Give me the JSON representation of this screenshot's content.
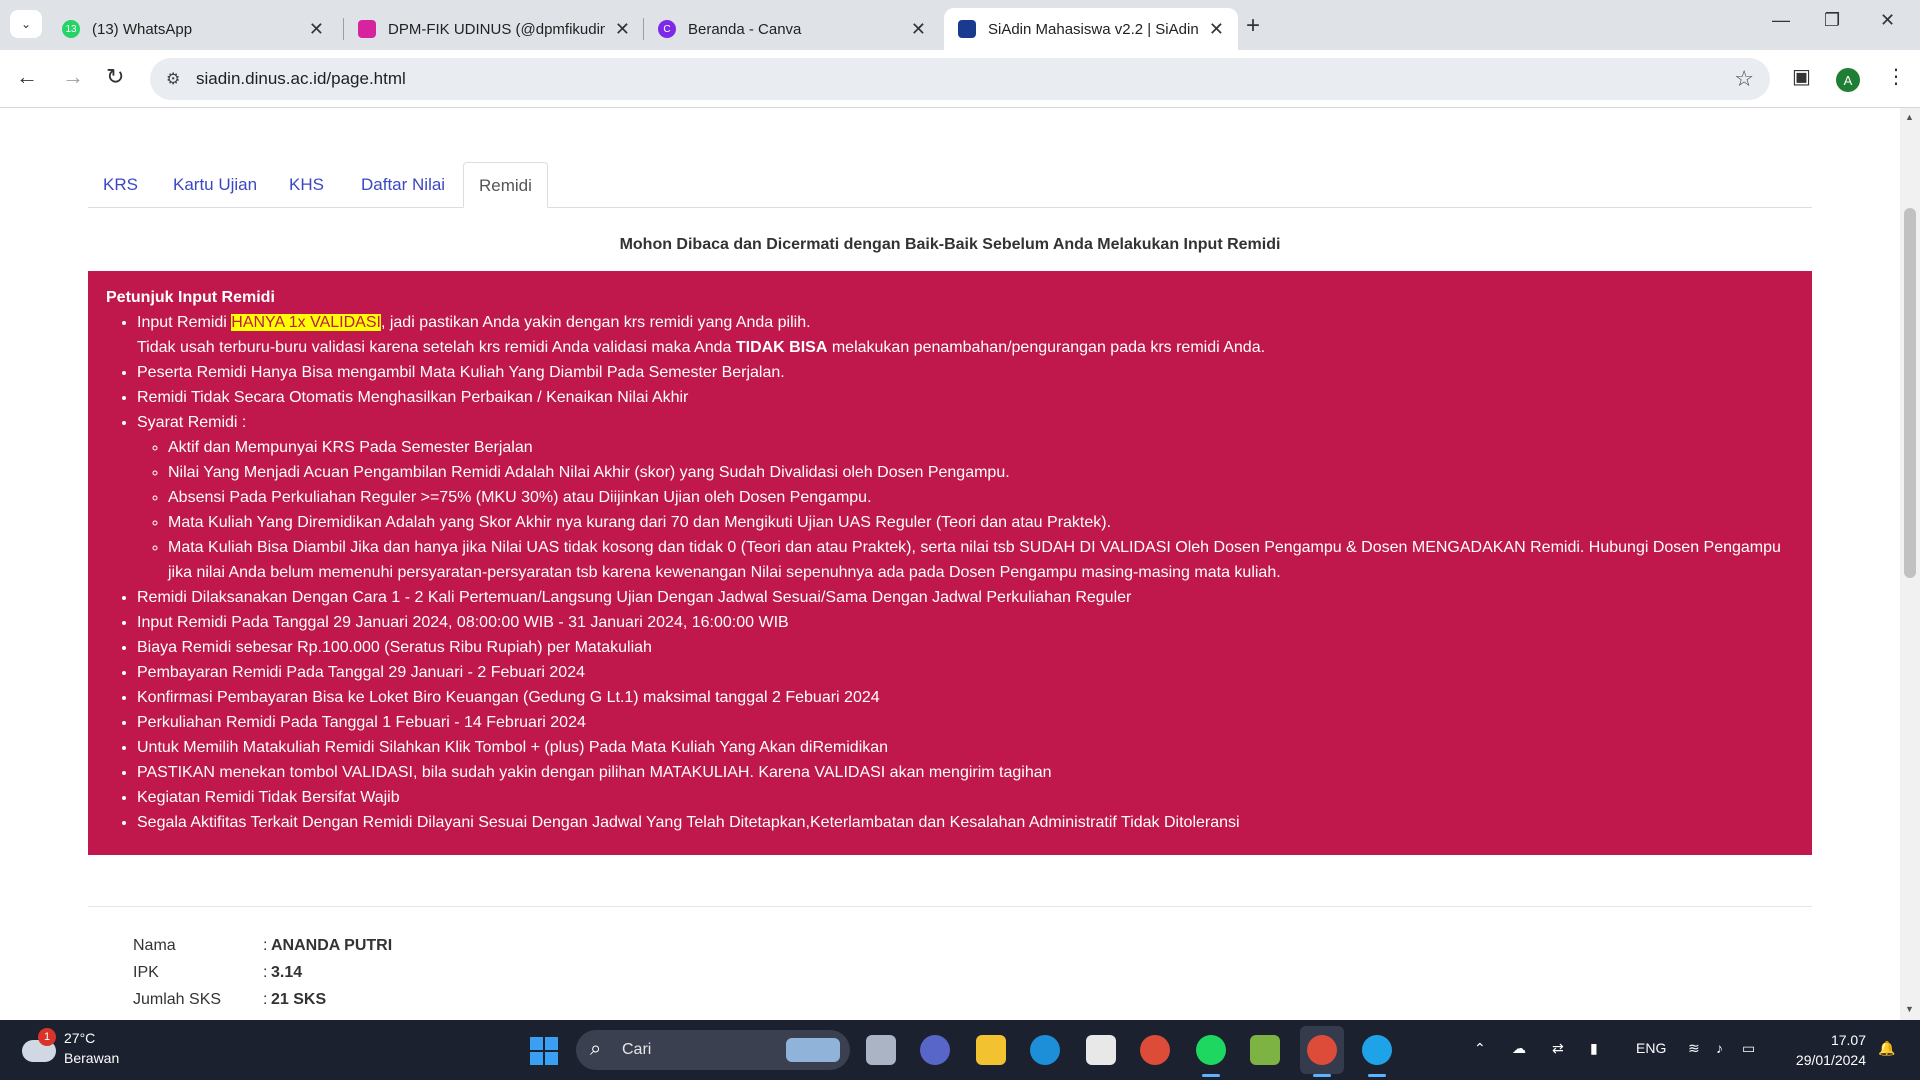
{
  "browser": {
    "tabs": [
      {
        "title": "(13) WhatsApp",
        "badge": "13",
        "color": "#25d366"
      },
      {
        "title": "DPM-FIK UDINUS (@dpmfikudinus)",
        "color": "#d6249f"
      },
      {
        "title": "Beranda - Canva",
        "color": "#7d2ae8"
      },
      {
        "title": "SiAdin Mahasiswa v2.2 | SiAdin",
        "color": "#1a3a8f"
      }
    ],
    "url": "siadin.dinus.ac.id/page.html",
    "profile_initial": "A"
  },
  "page": {
    "tabs": [
      "KRS",
      "Kartu Ujian",
      "KHS",
      "Daftar Nilai",
      "Remidi"
    ],
    "notice_title": "Mohon Dibaca dan Dicermati dengan Baik-Baik Sebelum Anda Melakukan Input Remidi",
    "box": {
      "title": "Petunjuk Input Remidi",
      "item1": {
        "a": "Input Remidi ",
        "highlight": "HANYA 1x VALIDASI",
        "b": ", jadi pastikan Anda yakin dengan krs remidi yang Anda pilih.",
        "c": "Tidak usah terburu-buru validasi karena setelah krs remidi Anda validasi maka Anda ",
        "bold": "TIDAK BISA",
        "d": " melakukan penambahan/pengurangan pada krs remidi Anda."
      },
      "item2": "Peserta Remidi Hanya Bisa mengambil Mata Kuliah Yang Diambil Pada Semester Berjalan.",
      "item3": "Remidi Tidak Secara Otomatis Menghasilkan Perbaikan / Kenaikan Nilai Akhir",
      "syarat_label": "Syarat Remidi :",
      "syarat": [
        "Aktif dan Mempunyai KRS Pada Semester Berjalan",
        "Nilai Yang Menjadi Acuan Pengambilan Remidi Adalah Nilai Akhir (skor) yang Sudah Divalidasi oleh Dosen Pengampu.",
        "Absensi Pada Perkuliahan Reguler >=75% (MKU 30%) atau Diijinkan Ujian oleh Dosen Pengampu.",
        "Mata Kuliah Yang Diremidikan Adalah yang Skor Akhir nya kurang dari 70 dan Mengikuti Ujian UAS Reguler (Teori dan atau Praktek).",
        "Mata Kuliah Bisa Diambil Jika dan hanya jika Nilai UAS tidak kosong dan tidak 0 (Teori dan atau Praktek), serta nilai tsb SUDAH DI VALIDASI Oleh Dosen Pengampu & Dosen MENGADAKAN Remidi. Hubungi Dosen Pengampu jika nilai Anda belum memenuhi persyaratan-persyaratan tsb karena kewenangan Nilai sepenuhnya ada pada Dosen Pengampu masing-masing mata kuliah."
      ],
      "rest": [
        "Remidi Dilaksanakan Dengan Cara 1 - 2 Kali Pertemuan/Langsung Ujian Dengan Jadwal Sesuai/Sama Dengan Jadwal Perkuliahan Reguler",
        "Input Remidi Pada Tanggal 29 Januari 2024, 08:00:00 WIB - 31 Januari 2024, 16:00:00 WIB",
        "Biaya Remidi sebesar Rp.100.000 (Seratus Ribu Rupiah) per Matakuliah",
        "Pembayaran Remidi Pada Tanggal 29 Januari - 2 Febuari 2024",
        "Konfirmasi Pembayaran Bisa ke Loket Biro Keuangan (Gedung G Lt.1) maksimal tanggal 2 Febuari 2024",
        "Perkuliahan Remidi Pada Tanggal 1 Febuari - 14 Februari 2024",
        "Untuk Memilih Matakuliah Remidi Silahkan Klik Tombol + (plus) Pada Mata Kuliah Yang Akan diRemidikan",
        "PASTIKAN menekan tombol VALIDASI, bila sudah yakin dengan pilihan MATAKULIAH. Karena VALIDASI akan mengirim tagihan",
        "Kegiatan Remidi Tidak Bersifat Wajib",
        "Segala Aktifitas Terkait Dengan Remidi Dilayani Sesuai Dengan Jadwal Yang Telah Ditetapkan,Keterlambatan dan Kesalahan Administratif Tidak Ditoleransi"
      ]
    },
    "student": [
      {
        "label": "Nama",
        "value": "ANANDA PUTRI"
      },
      {
        "label": "IPK",
        "value": "3.14"
      },
      {
        "label": "Jumlah SKS",
        "value": "21 SKS"
      }
    ]
  },
  "taskbar": {
    "weather_temp": "27°C",
    "weather_desc": "Berawan",
    "weather_badge": "1",
    "search_label": "Cari",
    "lang": "ENG",
    "time": "17.07",
    "date": "29/01/2024"
  },
  "colors": {
    "notice_bg": "#c0184c",
    "highlight": "#ffff00",
    "link": "#3b48c2"
  }
}
